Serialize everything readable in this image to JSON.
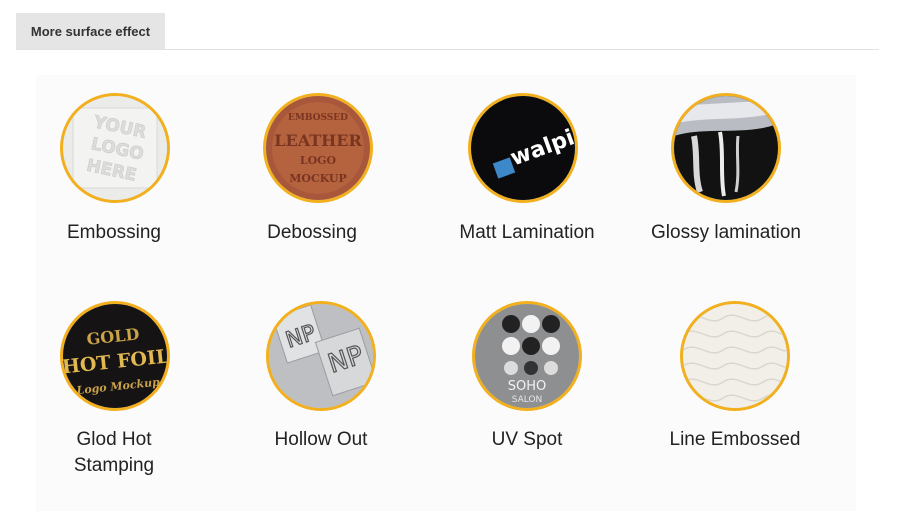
{
  "tab": {
    "label": "More surface effect"
  },
  "items": [
    {
      "label": "Embossing",
      "icon": "embossing-sample-icon",
      "texts": [
        "YOUR",
        "LOGO",
        "HERE"
      ]
    },
    {
      "label": "Debossing",
      "icon": "debossing-sample-icon",
      "texts": [
        "EMBOSSED",
        "LEATHER",
        "LOGO",
        "MOCKUP"
      ]
    },
    {
      "label": "Matt Lamination",
      "icon": "matt-lamination-sample-icon",
      "texts": [
        "walpis"
      ]
    },
    {
      "label": "Glossy lamination",
      "icon": "glossy-lamination-sample-icon",
      "texts": []
    },
    {
      "label": "Glod Hot\nStamping",
      "icon": "hot-stamping-sample-icon",
      "texts": [
        "GOLD",
        "HOT FOIL",
        "Logo Mockup"
      ]
    },
    {
      "label": "Hollow Out",
      "icon": "hollow-out-sample-icon",
      "texts": [
        "NP",
        "NP"
      ]
    },
    {
      "label": "UV Spot",
      "icon": "uv-spot-sample-icon",
      "texts": [
        "SOHO",
        "SALON"
      ]
    },
    {
      "label": "Line Embossed",
      "icon": "line-embossed-sample-icon",
      "texts": []
    }
  ],
  "colors": {
    "ring": "#f2b01e",
    "tab_bg": "#e5e5e5"
  }
}
